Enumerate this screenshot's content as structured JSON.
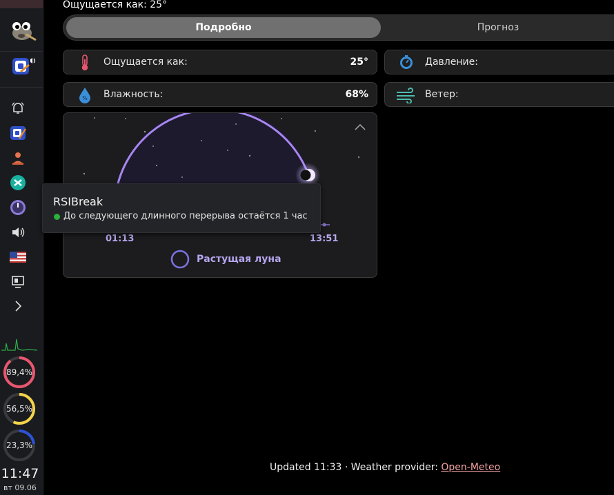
{
  "panel": {
    "apps": [
      "gimp-icon",
      "app-icon-sound"
    ],
    "tray": [
      "bell-icon",
      "app-icon",
      "user-icon",
      "sync-icon",
      "rsibreak-icon",
      "volume-icon",
      "flag-us-icon",
      "monitor-icon",
      "chevron-right-icon"
    ],
    "monitors": [
      {
        "label": "89,4%",
        "value": 0.894,
        "color": "#e8576f"
      },
      {
        "label": "56,5%",
        "value": 0.565,
        "color": "#f3d34a"
      },
      {
        "label": "23,3%",
        "value": 0.233,
        "color": "#2c52d8"
      }
    ],
    "clock": {
      "time": "11:47",
      "date": "вт 09.06"
    }
  },
  "weather": {
    "feels_top": "Ощущается как: 25°",
    "tabs": {
      "detail": "Подробно",
      "forecast": "Прогноз"
    },
    "cards": {
      "feels_label": "Ощущается как:",
      "feels_value": "25°",
      "pressure_label": "Давление:",
      "humidity_label": "Влажность:",
      "humidity_value": "68%",
      "wind_label": "Ветер:"
    },
    "moon": {
      "rise": "01:13",
      "set": "13:51",
      "phase": "Растущая луна"
    },
    "footer": {
      "prefix": "Updated 11:33 · Weather provider: ",
      "link": "Open-Meteo"
    }
  },
  "tooltip": {
    "title": "RSIBreak",
    "body": "До следующего длинного перерыва остаётся 1 час"
  }
}
